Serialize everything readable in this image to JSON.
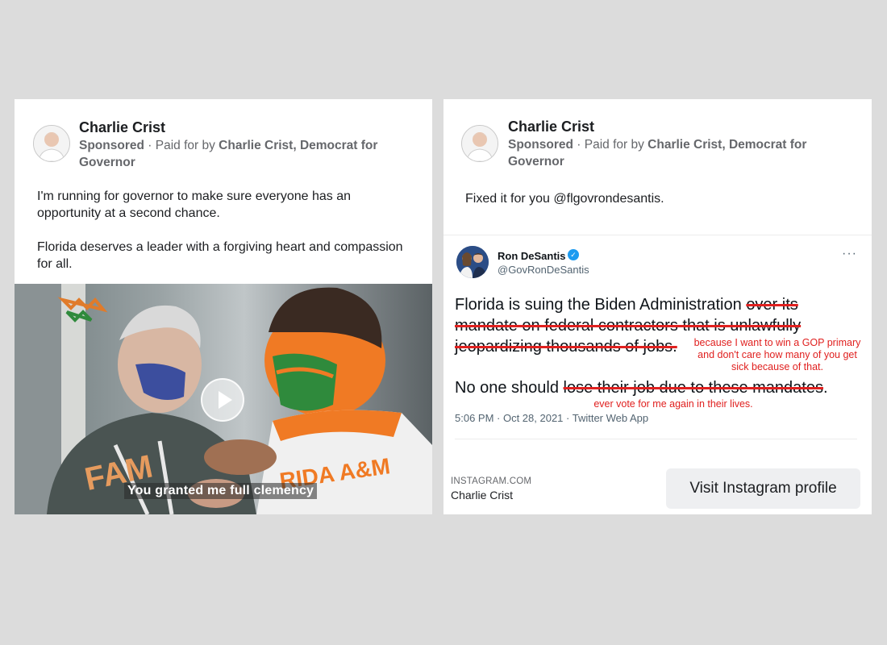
{
  "left_post": {
    "author": "Charlie Crist",
    "sponsored": "Sponsored",
    "separator": "·",
    "paid_for_prefix": "Paid for by",
    "paid_for_by": "Charlie Crist, Democrat for Governor",
    "paragraph1": "I'm running for governor to make sure everyone has an opportunity at a second chance.",
    "paragraph2": "Florida deserves a leader with a forgiving heart and compassion for all.",
    "video_caption": "You granted me full clemency"
  },
  "right_post": {
    "author": "Charlie Crist",
    "sponsored": "Sponsored",
    "separator": "·",
    "paid_for_prefix": "Paid for by",
    "paid_for_by": "Charlie Crist, Democrat for Governor",
    "text": "Fixed it for you @flgovrondesantis.",
    "tweet": {
      "name": "Ron DeSantis",
      "handle": "@GovRonDeSantis",
      "more": "···",
      "line1_plain": "Florida is suing the Biden Administration ",
      "line1_struck": "over its",
      "line2_struck": "mandate on federal contractors that is unlawfully",
      "line3_struck": "jeopardizing thousands of jobs.",
      "note1": "because I want to win a GOP primary and don't care how many of you get sick because of that.",
      "line4_plain": "No one should ",
      "line4_struck": "lose their job due to these mandates",
      "line4_end": ".",
      "note2": "ever vote for me again in their lives.",
      "timestamp": "5:06 PM · Oct 28, 2021 · Twitter Web App"
    },
    "link_domain": "INSTAGRAM.COM",
    "link_source": "Charlie Crist",
    "cta_label": "Visit Instagram profile"
  },
  "colors": {
    "background": "#dcdcdc",
    "annotation_red": "#e0201f",
    "verified_blue": "#1d9bf0"
  }
}
